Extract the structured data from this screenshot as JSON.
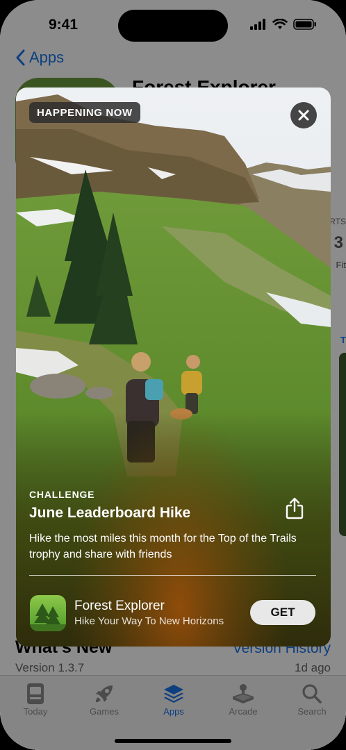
{
  "status_bar": {
    "time": "9:41"
  },
  "nav": {
    "back_label": "Apps"
  },
  "background_page": {
    "app_title": "Forest Explorer",
    "whats_new": "What's New",
    "version_history": "Version History",
    "version": "Version 1.3.7",
    "updated": "1d ago",
    "side_text_1": "RTS",
    "side_text_2": "3",
    "side_text_3": "Fit",
    "side_text_4": "T"
  },
  "event_card": {
    "badge": "HAPPENING NOW",
    "kicker": "CHALLENGE",
    "title": "June Leaderboard Hike",
    "description": "Hike the most miles this month for the Top of the Trails trophy and share with friends",
    "app_name": "Forest Explorer",
    "app_subtitle": "Hike Your Way To New Horizons",
    "get_label": "GET"
  },
  "tab_bar": {
    "tabs": [
      {
        "label": "Today",
        "icon": "today-icon",
        "active": false
      },
      {
        "label": "Games",
        "icon": "rocket-icon",
        "active": false
      },
      {
        "label": "Apps",
        "icon": "layers-icon",
        "active": true
      },
      {
        "label": "Arcade",
        "icon": "joystick-icon",
        "active": false
      },
      {
        "label": "Search",
        "icon": "search-icon",
        "active": false
      }
    ]
  },
  "colors": {
    "accent": "#1a73e8",
    "card_bg": "#3d4a20",
    "get_button": "#e8e8e8"
  }
}
